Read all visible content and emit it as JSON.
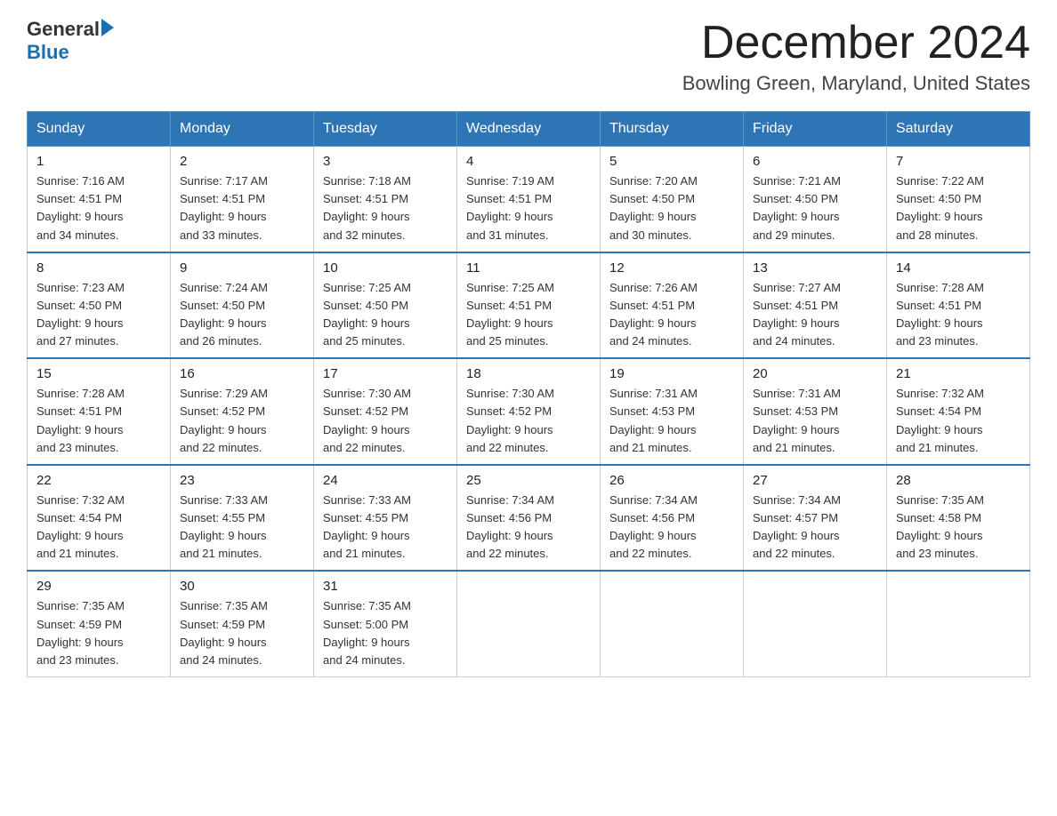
{
  "header": {
    "logo_general": "General",
    "logo_blue": "Blue",
    "month_title": "December 2024",
    "location": "Bowling Green, Maryland, United States"
  },
  "days_of_week": [
    "Sunday",
    "Monday",
    "Tuesday",
    "Wednesday",
    "Thursday",
    "Friday",
    "Saturday"
  ],
  "weeks": [
    [
      {
        "day": "1",
        "sunrise": "7:16 AM",
        "sunset": "4:51 PM",
        "daylight": "9 hours and 34 minutes."
      },
      {
        "day": "2",
        "sunrise": "7:17 AM",
        "sunset": "4:51 PM",
        "daylight": "9 hours and 33 minutes."
      },
      {
        "day": "3",
        "sunrise": "7:18 AM",
        "sunset": "4:51 PM",
        "daylight": "9 hours and 32 minutes."
      },
      {
        "day": "4",
        "sunrise": "7:19 AM",
        "sunset": "4:51 PM",
        "daylight": "9 hours and 31 minutes."
      },
      {
        "day": "5",
        "sunrise": "7:20 AM",
        "sunset": "4:50 PM",
        "daylight": "9 hours and 30 minutes."
      },
      {
        "day": "6",
        "sunrise": "7:21 AM",
        "sunset": "4:50 PM",
        "daylight": "9 hours and 29 minutes."
      },
      {
        "day": "7",
        "sunrise": "7:22 AM",
        "sunset": "4:50 PM",
        "daylight": "9 hours and 28 minutes."
      }
    ],
    [
      {
        "day": "8",
        "sunrise": "7:23 AM",
        "sunset": "4:50 PM",
        "daylight": "9 hours and 27 minutes."
      },
      {
        "day": "9",
        "sunrise": "7:24 AM",
        "sunset": "4:50 PM",
        "daylight": "9 hours and 26 minutes."
      },
      {
        "day": "10",
        "sunrise": "7:25 AM",
        "sunset": "4:50 PM",
        "daylight": "9 hours and 25 minutes."
      },
      {
        "day": "11",
        "sunrise": "7:25 AM",
        "sunset": "4:51 PM",
        "daylight": "9 hours and 25 minutes."
      },
      {
        "day": "12",
        "sunrise": "7:26 AM",
        "sunset": "4:51 PM",
        "daylight": "9 hours and 24 minutes."
      },
      {
        "day": "13",
        "sunrise": "7:27 AM",
        "sunset": "4:51 PM",
        "daylight": "9 hours and 24 minutes."
      },
      {
        "day": "14",
        "sunrise": "7:28 AM",
        "sunset": "4:51 PM",
        "daylight": "9 hours and 23 minutes."
      }
    ],
    [
      {
        "day": "15",
        "sunrise": "7:28 AM",
        "sunset": "4:51 PM",
        "daylight": "9 hours and 23 minutes."
      },
      {
        "day": "16",
        "sunrise": "7:29 AM",
        "sunset": "4:52 PM",
        "daylight": "9 hours and 22 minutes."
      },
      {
        "day": "17",
        "sunrise": "7:30 AM",
        "sunset": "4:52 PM",
        "daylight": "9 hours and 22 minutes."
      },
      {
        "day": "18",
        "sunrise": "7:30 AM",
        "sunset": "4:52 PM",
        "daylight": "9 hours and 22 minutes."
      },
      {
        "day": "19",
        "sunrise": "7:31 AM",
        "sunset": "4:53 PM",
        "daylight": "9 hours and 21 minutes."
      },
      {
        "day": "20",
        "sunrise": "7:31 AM",
        "sunset": "4:53 PM",
        "daylight": "9 hours and 21 minutes."
      },
      {
        "day": "21",
        "sunrise": "7:32 AM",
        "sunset": "4:54 PM",
        "daylight": "9 hours and 21 minutes."
      }
    ],
    [
      {
        "day": "22",
        "sunrise": "7:32 AM",
        "sunset": "4:54 PM",
        "daylight": "9 hours and 21 minutes."
      },
      {
        "day": "23",
        "sunrise": "7:33 AM",
        "sunset": "4:55 PM",
        "daylight": "9 hours and 21 minutes."
      },
      {
        "day": "24",
        "sunrise": "7:33 AM",
        "sunset": "4:55 PM",
        "daylight": "9 hours and 21 minutes."
      },
      {
        "day": "25",
        "sunrise": "7:34 AM",
        "sunset": "4:56 PM",
        "daylight": "9 hours and 22 minutes."
      },
      {
        "day": "26",
        "sunrise": "7:34 AM",
        "sunset": "4:56 PM",
        "daylight": "9 hours and 22 minutes."
      },
      {
        "day": "27",
        "sunrise": "7:34 AM",
        "sunset": "4:57 PM",
        "daylight": "9 hours and 22 minutes."
      },
      {
        "day": "28",
        "sunrise": "7:35 AM",
        "sunset": "4:58 PM",
        "daylight": "9 hours and 23 minutes."
      }
    ],
    [
      {
        "day": "29",
        "sunrise": "7:35 AM",
        "sunset": "4:59 PM",
        "daylight": "9 hours and 23 minutes."
      },
      {
        "day": "30",
        "sunrise": "7:35 AM",
        "sunset": "4:59 PM",
        "daylight": "9 hours and 24 minutes."
      },
      {
        "day": "31",
        "sunrise": "7:35 AM",
        "sunset": "5:00 PM",
        "daylight": "9 hours and 24 minutes."
      },
      null,
      null,
      null,
      null
    ]
  ],
  "labels": {
    "sunrise": "Sunrise:",
    "sunset": "Sunset:",
    "daylight": "Daylight:"
  }
}
